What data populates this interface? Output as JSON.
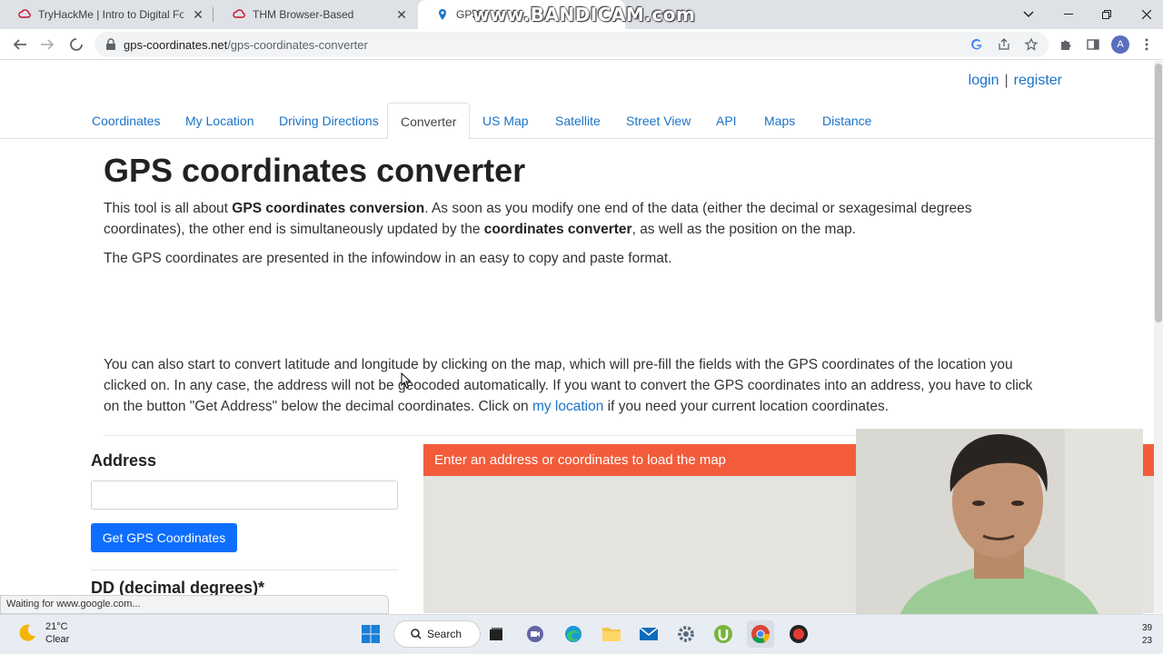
{
  "browser": {
    "tabs": [
      {
        "title": "TryHackMe | Intro to Digital Fore",
        "active": false,
        "close": "✕"
      },
      {
        "title": "THM Browser-Based",
        "active": false,
        "close": "✕"
      },
      {
        "title": "GPS c",
        "active": true,
        "close": ""
      }
    ],
    "watermark": "www.BANDICAM.com",
    "window_controls": {
      "minimize": "—",
      "maximize": "❐",
      "close": "✕",
      "tab_list": "⌄"
    },
    "url_host": "gps-coordinates.net",
    "url_path": "/gps-coordinates-converter",
    "profile_initial": "A"
  },
  "site": {
    "login": "login",
    "separator": "|",
    "register": "register",
    "nav": [
      "Coordinates",
      "My Location",
      "Driving Directions",
      "Converter",
      "US Map",
      "Satellite",
      "Street View",
      "API",
      "Maps",
      "Distance"
    ],
    "active_nav": "Converter"
  },
  "content": {
    "title": "GPS coordinates converter",
    "p1_a": "This tool is all about ",
    "p1_b": "GPS coordinates conversion",
    "p1_c": ". As soon as you modify one end of the data (either the decimal or sexagesimal degrees coordinates), the other end is simultaneously updated by the ",
    "p1_d": "coordinates converter",
    "p1_e": ", as well as the position on the map.",
    "p2": "The GPS coordinates are presented in the infowindow in an easy to copy and paste format.",
    "p3_a": "You can also start to convert latitude and longitude by clicking on the map, which will pre-fill the fields with the GPS coordinates of the location you clicked on. In any case, the address will not be geocoded automatically. If you want to convert the GPS coordinates into an address, you have to click on the button \"Get Address\" below the decimal coordinates. Click on ",
    "p3_link": "my location",
    "p3_b": " if you need your current location coordinates.",
    "address_label": "Address",
    "address_value": "",
    "get_gps_button": "Get GPS Coordinates",
    "dd_label": "DD (decimal degrees)*",
    "map_banner": "Enter an address or coordinates to load the map"
  },
  "status": "Waiting for www.google.com...",
  "taskbar": {
    "temperature": "21°C",
    "condition": "Clear",
    "search_label": "Search",
    "clock_top": "39",
    "clock_bottom": "23",
    "apps": [
      "windows-start",
      "file-explorer",
      "teams",
      "edge",
      "folder",
      "mail",
      "settings",
      "utorrent",
      "chrome",
      "record"
    ]
  },
  "colors": {
    "link": "#1a73c8",
    "button": "#0d6efd",
    "map_banner": "#f25c3a",
    "tab_strip": "#dee1e6"
  }
}
